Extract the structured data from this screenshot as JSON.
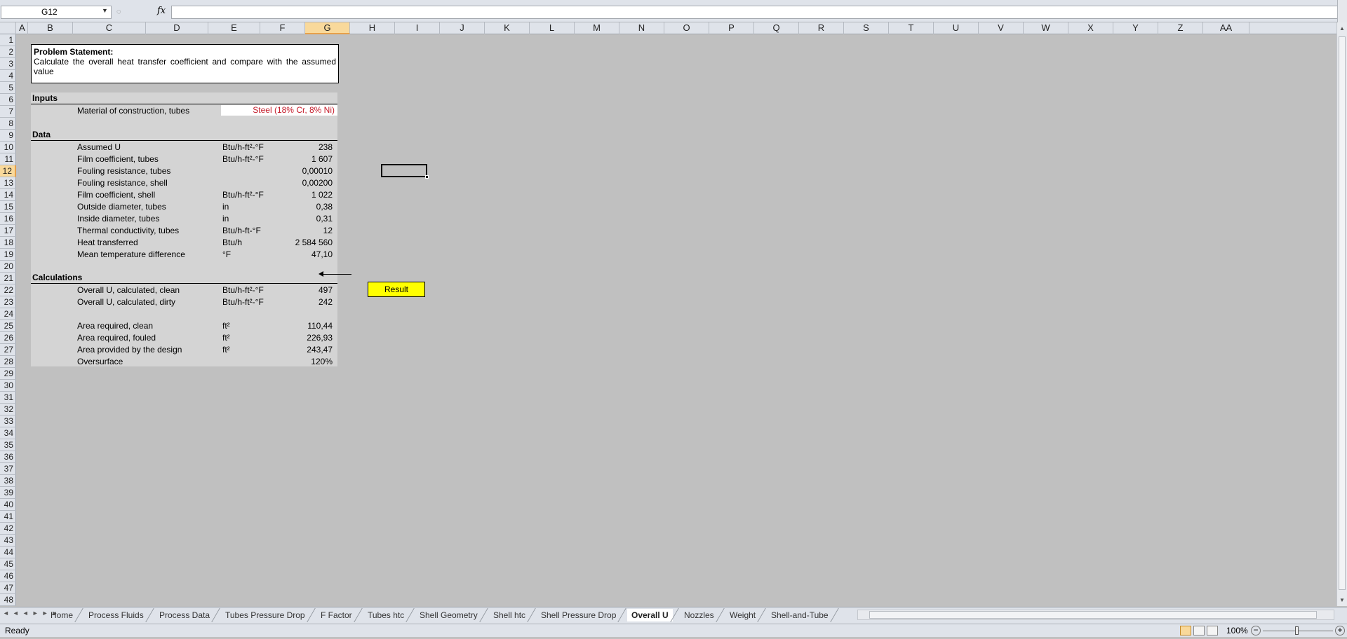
{
  "formula_bar": {
    "cell_ref": "G12",
    "fx_label": "fx",
    "formula": ""
  },
  "columns": [
    "A",
    "B",
    "C",
    "D",
    "E",
    "F",
    "G",
    "H",
    "I",
    "J",
    "K",
    "L",
    "M",
    "N",
    "O",
    "P",
    "Q",
    "R",
    "S",
    "T",
    "U",
    "V",
    "W",
    "X",
    "Y",
    "Z",
    "AA"
  ],
  "selected_column": "G",
  "rows": [
    "1",
    "2",
    "3",
    "4",
    "5",
    "6",
    "7",
    "8",
    "9",
    "10",
    "11",
    "12",
    "13",
    "14",
    "15",
    "16",
    "17",
    "18",
    "19",
    "20",
    "21",
    "22",
    "23",
    "24",
    "25",
    "26",
    "27",
    "28",
    "29",
    "30",
    "31",
    "32",
    "33",
    "34",
    "35",
    "36",
    "37",
    "38",
    "39",
    "40",
    "41",
    "42",
    "43",
    "44",
    "45",
    "46",
    "47",
    "48"
  ],
  "selected_row": "12",
  "problem": {
    "title": "Problem Statement:",
    "text": "Calculate the overall heat transfer coefficient and compare with the assumed value"
  },
  "inputs": {
    "title": "Inputs",
    "material_label": "Material of construction, tubes",
    "material_value": "Steel (18% Cr, 8% Ni)"
  },
  "data": {
    "title": "Data",
    "rows": [
      {
        "label": "Assumed U",
        "unit": "Btu/h-ft²-°F",
        "value": "238"
      },
      {
        "label": "Film coefficient, tubes",
        "unit": "Btu/h-ft²-°F",
        "value": "1 607"
      },
      {
        "label": "Fouling resistance, tubes",
        "unit": "",
        "value": "0,00010"
      },
      {
        "label": "Fouling resistance, shell",
        "unit": "",
        "value": "0,00200"
      },
      {
        "label": "Film coefficient, shell",
        "unit": "Btu/h-ft²-°F",
        "value": "1 022"
      },
      {
        "label": "Outside diameter, tubes",
        "unit": "in",
        "value": "0,38"
      },
      {
        "label": "Inside diameter, tubes",
        "unit": "in",
        "value": "0,31"
      },
      {
        "label": "Thermal conductivity, tubes",
        "unit": "Btu/h-ft-°F",
        "value": "12"
      },
      {
        "label": "Heat transferred",
        "unit": "Btu/h",
        "value": "2 584 560"
      },
      {
        "label": "Mean temperature difference",
        "unit": "°F",
        "value": "47,10"
      }
    ]
  },
  "calculations": {
    "title": "Calculations",
    "rows": [
      {
        "label": "Overall U, calculated, clean",
        "unit": "Btu/h-ft²-°F",
        "value": "497"
      },
      {
        "label": "Overall U, calculated, dirty",
        "unit": "Btu/h-ft²-°F",
        "value": "242"
      },
      {
        "label": "Area required, clean",
        "unit": "ft²",
        "value": "110,44"
      },
      {
        "label": "Area required, fouled",
        "unit": "ft²",
        "value": "226,93"
      },
      {
        "label": "Area provided by the design",
        "unit": "ft²",
        "value": "243,47"
      },
      {
        "label": "Oversurface",
        "unit": "",
        "value": "120%"
      }
    ]
  },
  "result_label": "Result",
  "sheet_tabs": [
    "Home",
    "Process Fluids",
    "Process Data",
    "Tubes Pressure Drop",
    "F Factor",
    "Tubes htc",
    "Shell Geometry",
    "Shell htc",
    "Shell Pressure Drop",
    "Overall U",
    "Nozzles",
    "Weight",
    "Shell-and-Tube"
  ],
  "active_tab": "Overall U",
  "status": {
    "ready": "Ready",
    "zoom": "100%"
  }
}
